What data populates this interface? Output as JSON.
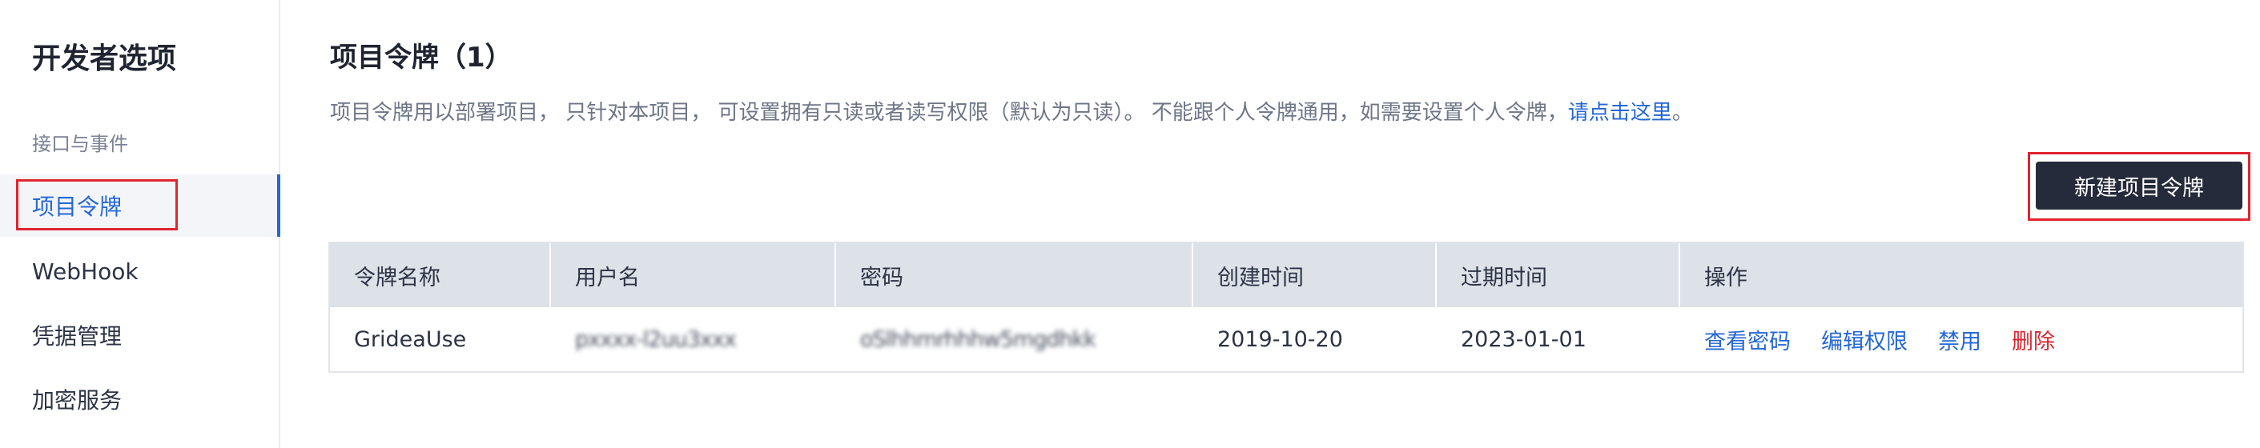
{
  "sidebar": {
    "title": "开发者选项",
    "group_label": "接口与事件",
    "items": [
      {
        "label": "项目令牌",
        "active": true
      },
      {
        "label": "WebHook",
        "active": false
      },
      {
        "label": "凭据管理",
        "active": false
      },
      {
        "label": "加密服务",
        "active": false
      }
    ]
  },
  "main": {
    "title": "项目令牌（1）",
    "description": "项目令牌用以部署项目， 只针对本项目， 可设置拥有只读或者读写权限（默认为只读）。 不能跟个人令牌通用，如需要设置个人令牌，",
    "description_link": "请点击这里",
    "description_end": "。",
    "new_button_label": "新建项目令牌"
  },
  "table": {
    "headers": [
      "令牌名称",
      "用户名",
      "密码",
      "创建时间",
      "过期时间",
      "操作"
    ],
    "rows": [
      {
        "name": "GrideaUse",
        "username": "pxxxx-l2uu3xxx",
        "password": "oSlhhmrhhhw5mgdhkk",
        "created": "2019-10-20",
        "expires": "2023-01-01",
        "actions": {
          "view_password": "查看密码",
          "edit_permissions": "编辑权限",
          "disable": "禁用",
          "delete": "删除"
        }
      }
    ]
  },
  "colors": {
    "accent": "#2467d6",
    "danger": "#d9262f",
    "button_bg": "#252b3a",
    "highlight_box": "#e0242f"
  }
}
